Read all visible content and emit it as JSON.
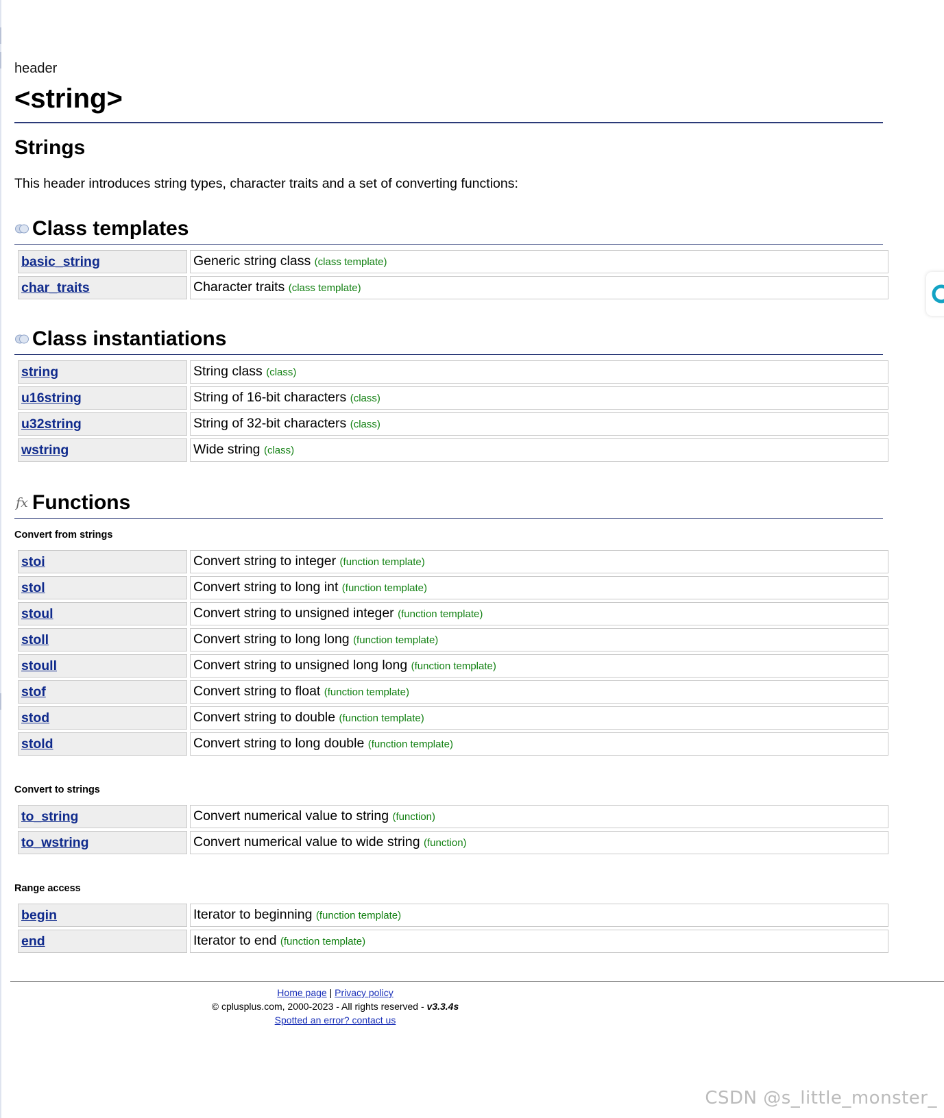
{
  "header": {
    "type_label": "header",
    "title": "<string>",
    "subtitle": "Strings",
    "intro": "This header introduces string types, character traits and a set of converting functions:"
  },
  "sections": {
    "class_templates": {
      "title": "Class templates",
      "icon": "class-icon",
      "items": [
        {
          "name": "basic_string",
          "desc": "Generic string class",
          "kind": "(class template)"
        },
        {
          "name": "char_traits",
          "desc": "Character traits",
          "kind": "(class template)"
        }
      ]
    },
    "class_instantiations": {
      "title": "Class instantiations",
      "icon": "class-icon",
      "items": [
        {
          "name": "string",
          "desc": "String class",
          "kind": "(class)"
        },
        {
          "name": "u16string",
          "desc": "String of 16-bit characters",
          "kind": "(class)"
        },
        {
          "name": "u32string",
          "desc": "String of 32-bit characters",
          "kind": "(class)"
        },
        {
          "name": "wstring",
          "desc": "Wide string",
          "kind": "(class)"
        }
      ]
    },
    "functions": {
      "title": "Functions",
      "icon": "fx-icon",
      "icon_glyph": "fx",
      "groups": [
        {
          "label": "Convert from strings",
          "items": [
            {
              "name": "stoi",
              "desc": "Convert string to integer",
              "kind": "(function template)"
            },
            {
              "name": "stol",
              "desc": "Convert string to long int",
              "kind": "(function template)"
            },
            {
              "name": "stoul",
              "desc": "Convert string to unsigned integer",
              "kind": "(function template)"
            },
            {
              "name": "stoll",
              "desc": "Convert string to long long",
              "kind": "(function template)"
            },
            {
              "name": "stoull",
              "desc": "Convert string to unsigned long long",
              "kind": "(function template)"
            },
            {
              "name": "stof",
              "desc": "Convert string to float",
              "kind": "(function template)"
            },
            {
              "name": "stod",
              "desc": "Convert string to double",
              "kind": "(function template)"
            },
            {
              "name": "stold",
              "desc": "Convert string to long double",
              "kind": "(function template)"
            }
          ]
        },
        {
          "label": "Convert to strings",
          "items": [
            {
              "name": "to_string",
              "desc": "Convert numerical value to string",
              "kind": "(function)"
            },
            {
              "name": "to_wstring",
              "desc": "Convert numerical value to wide string",
              "kind": "(function)"
            }
          ]
        },
        {
          "label": "Range access",
          "items": [
            {
              "name": "begin",
              "desc": "Iterator to beginning",
              "kind": "(function template)"
            },
            {
              "name": "end",
              "desc": "Iterator to end",
              "kind": "(function template)"
            }
          ]
        }
      ]
    }
  },
  "footer": {
    "home_link": "Home page",
    "separator": "|",
    "privacy_link": "Privacy policy",
    "copyright": "© cplusplus.com, 2000-2023 - All rights reserved - ",
    "version": "v3.3.4s",
    "error_link": "Spotted an error? contact us"
  },
  "watermark": "CSDN @s_little_monster_",
  "colors": {
    "link": "#0f2a8c",
    "kind": "#118011",
    "rule": "#2b3a78",
    "name_cell_bg": "#eeeeee"
  }
}
